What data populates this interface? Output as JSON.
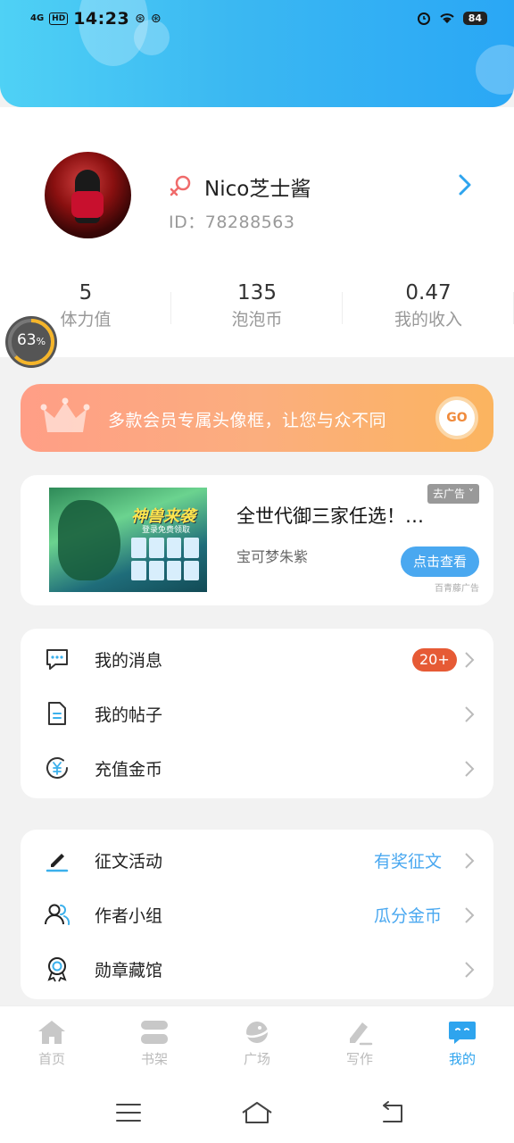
{
  "status_bar": {
    "signal": "4G",
    "hd": "HD",
    "time": "14:23",
    "weibo_1": "⊛",
    "weibo_2": "⊛",
    "battery": "84"
  },
  "profile": {
    "name": "Nico芝士酱",
    "id": "ID：78288563"
  },
  "stats": [
    {
      "value": "5",
      "label": "体力值"
    },
    {
      "value": "135",
      "label": "泡泡币"
    },
    {
      "value": "0.47",
      "label": "我的收入"
    }
  ],
  "progress": {
    "value": "63",
    "unit": "%",
    "fraction": 0.63
  },
  "vip_banner": {
    "text": "多款会员专属头像框，让您与众不同",
    "go_label": "GO"
  },
  "ad": {
    "image_title": "神兽来袭",
    "image_subtitle": "登录免费领取",
    "title": "全世代御三家任选！…",
    "source": "宝可梦朱紫",
    "close_label": "去广告 ˅",
    "cta_label": "点击查看",
    "provider": "百青藤广告"
  },
  "menu_group_1": [
    {
      "label": "我的消息",
      "badge": "20+",
      "icon": "message-icon"
    },
    {
      "label": "我的帖子",
      "icon": "document-icon"
    },
    {
      "label": "充值金币",
      "icon": "coin-icon"
    }
  ],
  "menu_group_2": [
    {
      "label": "征文活动",
      "extra": "有奖征文",
      "icon": "pen-icon"
    },
    {
      "label": "作者小组",
      "extra": "瓜分金币",
      "icon": "group-icon"
    },
    {
      "label": "勋章藏馆",
      "icon": "medal-icon"
    }
  ],
  "tabbar": [
    {
      "label": "首页",
      "icon": "home-icon"
    },
    {
      "label": "书架",
      "icon": "bookshelf-icon"
    },
    {
      "label": "广场",
      "icon": "planet-icon"
    },
    {
      "label": "写作",
      "icon": "write-icon"
    },
    {
      "label": "我的",
      "icon": "chat-bubble-icon",
      "active": true
    }
  ],
  "colors": {
    "accent": "#2ea4ee",
    "header_gradient_start": "#4fd1f5",
    "header_gradient_end": "#2aa7f5",
    "badge": "#e65a35",
    "vip_gradient_start": "#ff9e86",
    "vip_gradient_end": "#fbb45f"
  }
}
